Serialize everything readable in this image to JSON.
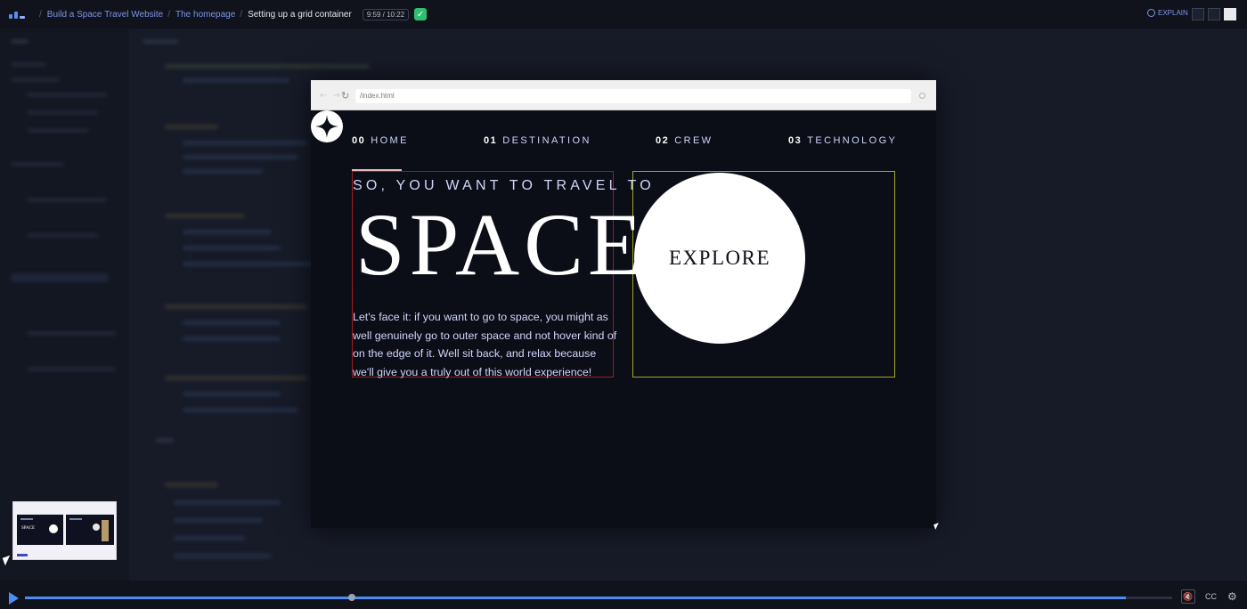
{
  "topbar": {
    "breadcrumbs": [
      "Build a Space Travel Website",
      "The homepage"
    ],
    "current": "Setting up a grid container",
    "time": "9:59 / 10:22",
    "explain_label": "EXPLAIN"
  },
  "browser": {
    "url": "/index.html"
  },
  "site": {
    "nav": [
      {
        "num": "00",
        "label": "HOME"
      },
      {
        "num": "01",
        "label": "DESTINATION"
      },
      {
        "num": "02",
        "label": "CREW"
      },
      {
        "num": "03",
        "label": "TECHNOLOGY"
      }
    ],
    "subtitle": "SO, YOU WANT TO TRAVEL TO",
    "hero": "SPACE",
    "paragraph": "Let's face it: if you want to go to space, you might as well genuinely go to outer space and not hover kind of on the edge of it. Well sit back, and relax because we'll give you a truly out of this world experience!",
    "cta": "EXPLORE"
  },
  "thumbnail": {
    "label": "SPACE"
  },
  "player": {
    "progress": 0.96,
    "marker": 0.285,
    "cc_label": "CC"
  },
  "colors": {
    "accent": "#4d8cf0",
    "grid_left_border": "#9b1c22",
    "grid_right_border": "#a3a82a",
    "site_bg": "#0b0d17"
  }
}
